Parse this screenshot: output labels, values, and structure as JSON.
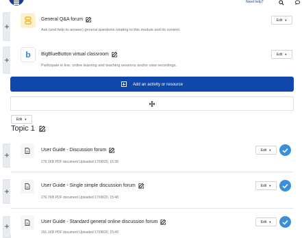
{
  "header": {
    "need_help_label": "Need help?",
    "search_icon": "search-icon",
    "chat_icon": "chat-icon",
    "menu_icon": "menu-icon"
  },
  "activities_top": [
    {
      "title": "General Q&A forum",
      "description": "Ask (and help to answer) general questions relating to this module and its content.",
      "icon": "forum-icon",
      "icon_bg": "#fdf0d0",
      "icon_color": "#f0a800",
      "edit_label": "Edit"
    },
    {
      "title": "BigBlueButton virtual classroom",
      "description": "Participate in live, online learning and teaching sessions and/or view recordings.",
      "icon": "bigbluebutton-icon",
      "icon_bg": "#ffffff",
      "icon_color": "#2b7fe0",
      "edit_label": "Edit"
    }
  ],
  "add_activity_label": "Add an activity or resource",
  "topic": {
    "edit_label": "Edit",
    "title": "Topic 1",
    "items": [
      {
        "title": "User Guide - Discussion forum",
        "meta": "279.1KB PDF document Uploaded 17/08/20, 15:38",
        "edit_label": "Edit"
      },
      {
        "title": "User Guide - Single simple discussion forum",
        "meta": "276.7KB PDF document Uploaded 17/08/20, 15:48",
        "edit_label": "Edit"
      },
      {
        "title": "User Guide - Standard general online discussion forum",
        "meta": "291.1KB PDF document Uploaded 17/08/20, 15:49",
        "edit_label": "Edit"
      }
    ]
  },
  "colors": {
    "primary": "#0f47ad",
    "check": "#3b8fd9",
    "muted_text": "#6a737b"
  }
}
